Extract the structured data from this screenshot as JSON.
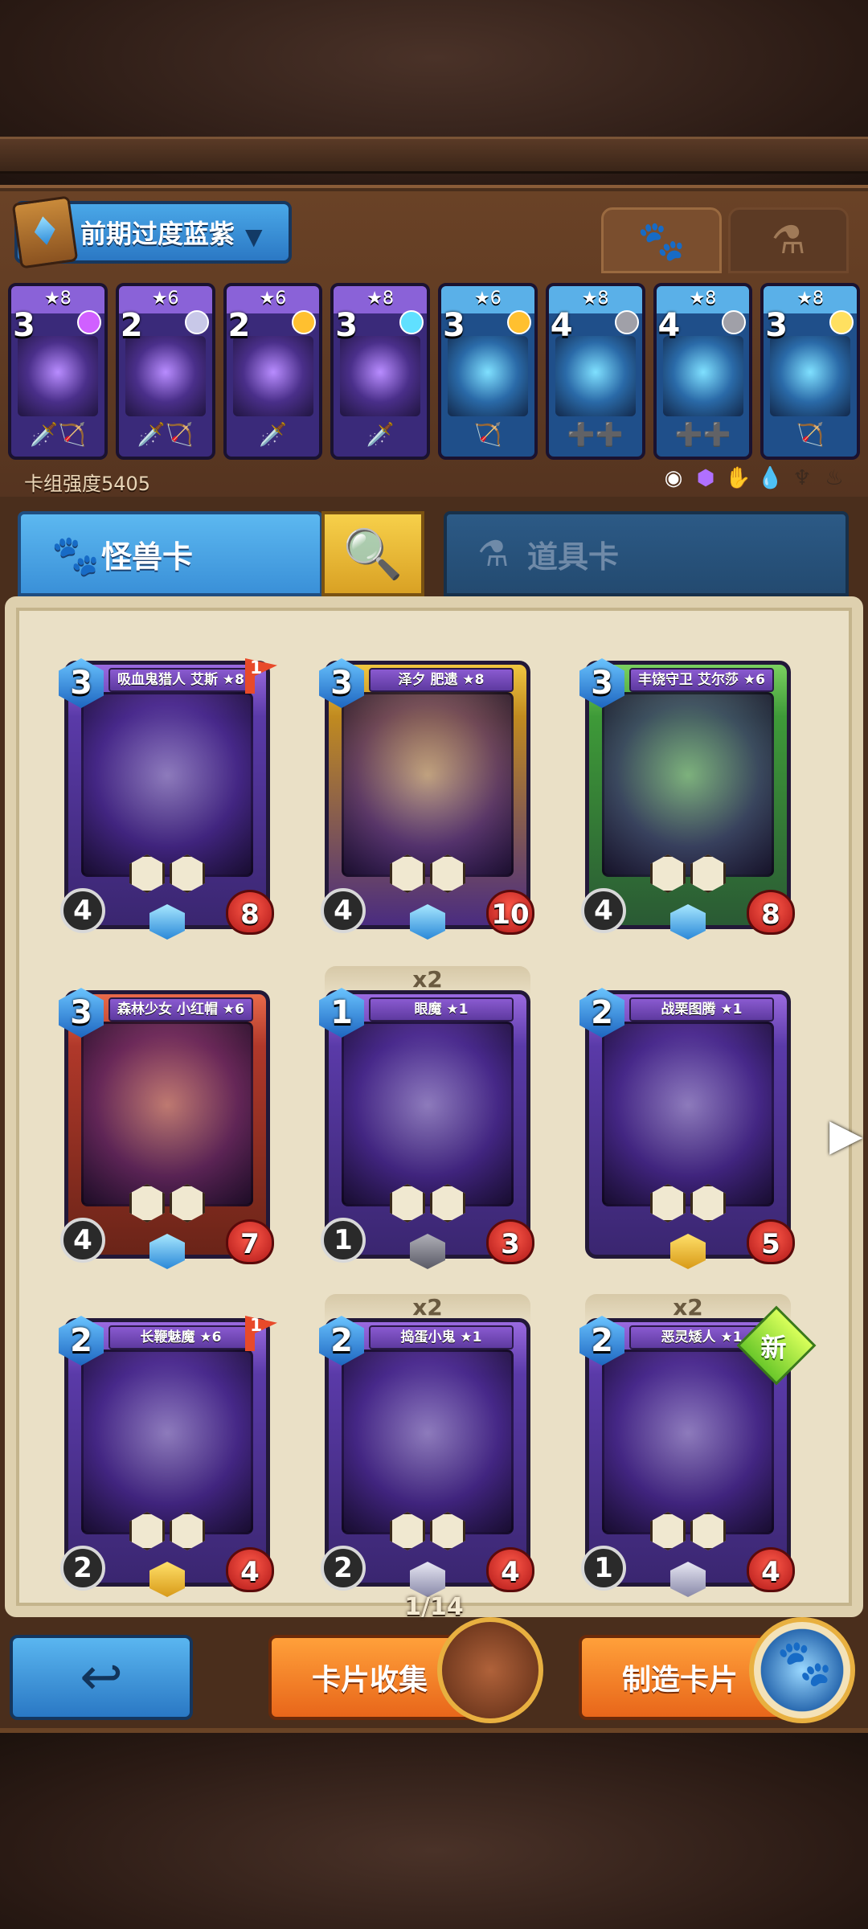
{
  "deck": {
    "name": "前期过度蓝紫",
    "strength_label": "卡组强度5405",
    "mini_cards": [
      {
        "stars": "★8",
        "cost": "3",
        "theme": "purple",
        "gem": "#d060ff",
        "icons": "🗡️🏹"
      },
      {
        "stars": "★6",
        "cost": "2",
        "theme": "purple",
        "gem": "#c8c8e8",
        "icons": "🗡️🏹"
      },
      {
        "stars": "★6",
        "cost": "2",
        "theme": "purple",
        "gem": "#ffc030",
        "icons": "🗡️"
      },
      {
        "stars": "★8",
        "cost": "3",
        "theme": "purple",
        "gem": "#60e0ff",
        "icons": "🗡️"
      },
      {
        "stars": "★6",
        "cost": "3",
        "theme": "blue",
        "gem": "#ffc030",
        "icons": "🏹"
      },
      {
        "stars": "★8",
        "cost": "4",
        "theme": "blue",
        "gem": "#a0a0a8",
        "icons": "➕➕"
      },
      {
        "stars": "★8",
        "cost": "4",
        "theme": "blue",
        "gem": "#a0a0a8",
        "icons": "➕➕"
      },
      {
        "stars": "★8",
        "cost": "3",
        "theme": "blue",
        "gem": "#ffe060",
        "icons": "🏹"
      }
    ]
  },
  "tabs": {
    "monster_cards": "怪兽卡",
    "item_cards": "道具卡"
  },
  "cards": [
    {
      "name": "吸血鬼猎人 艾斯 ★8",
      "cost": "3",
      "atk": "4",
      "hp": "8",
      "theme": "purple",
      "rarity": "rarity-star",
      "flag": "1",
      "count": ""
    },
    {
      "name": "泽夕 肥遗 ★8",
      "cost": "3",
      "atk": "4",
      "hp": "10",
      "theme": "gold",
      "rarity": "rarity-star",
      "flag": "",
      "count": ""
    },
    {
      "name": "丰饶守卫 艾尔莎 ★6",
      "cost": "3",
      "atk": "4",
      "hp": "8",
      "theme": "green",
      "rarity": "rarity-star",
      "flag": "",
      "count": ""
    },
    {
      "name": "森林少女 小红帽 ★6",
      "cost": "3",
      "atk": "4",
      "hp": "7",
      "theme": "red",
      "rarity": "rarity-star",
      "flag": "",
      "count": ""
    },
    {
      "name": "眼魔 ★1",
      "cost": "1",
      "atk": "1",
      "hp": "3",
      "theme": "purple",
      "rarity": "rarity-grey",
      "flag": "",
      "count": "x2"
    },
    {
      "name": "战栗图腾 ★1",
      "cost": "2",
      "atk": "",
      "hp": "5",
      "theme": "purple",
      "rarity": "rarity-gold",
      "flag": "",
      "count": ""
    },
    {
      "name": "长鞭魅魔 ★6",
      "cost": "2",
      "atk": "2",
      "hp": "4",
      "theme": "purple",
      "rarity": "rarity-gold",
      "flag": "1",
      "count": ""
    },
    {
      "name": "捣蛋小鬼 ★1",
      "cost": "2",
      "atk": "2",
      "hp": "4",
      "theme": "purple",
      "rarity": "rarity-silver",
      "flag": "",
      "count": "x2"
    },
    {
      "name": "恶灵矮人 ★1",
      "cost": "2",
      "atk": "1",
      "hp": "4",
      "theme": "purple",
      "rarity": "rarity-silver",
      "flag": "",
      "count": "x2",
      "new_label": "新"
    }
  ],
  "pagination": "1/14",
  "buttons": {
    "collect": "卡片收集",
    "craft": "制造卡片"
  }
}
